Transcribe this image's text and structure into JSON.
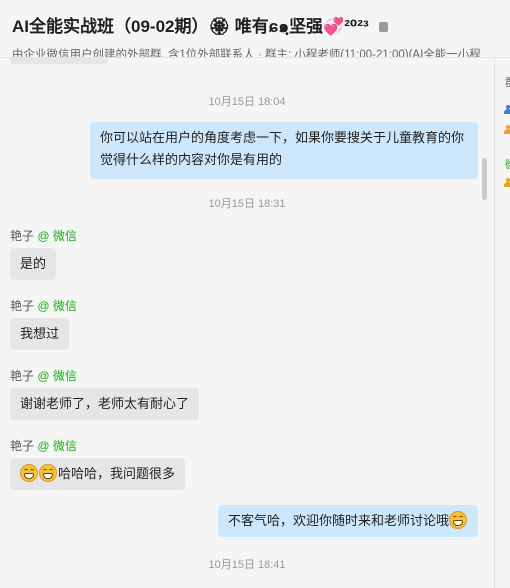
{
  "header": {
    "title": "AI全能实战班（09-02期）🏵 唯有ɕ๑ฺ坚强💞²⁰²³",
    "subtitle": "由企业微信用户创建的外部群, 含1位外部联系人 · 群主: 小程老师(11:00-21;00)(AI全能一小程"
  },
  "side_panel": {
    "glyphs": [
      "群",
      "微"
    ]
  },
  "messages": [
    {
      "kind": "timestamp",
      "text": "10月15日 18:04"
    },
    {
      "kind": "out",
      "text_line1": "你可以站在用户的角度考虑一下，如果你要搜关于儿童教育的你",
      "text_line2": "觉得什么样的内容对你是有用的"
    },
    {
      "kind": "timestamp",
      "text": "10月15日 18:31"
    },
    {
      "kind": "in",
      "sender": "艳子",
      "source": "@ 微信",
      "text": "是的"
    },
    {
      "kind": "in",
      "sender": "艳子",
      "source": "@ 微信",
      "text": "我想过"
    },
    {
      "kind": "in",
      "sender": "艳子",
      "source": "@ 微信",
      "text": "谢谢老师了，老师太有耐心了"
    },
    {
      "kind": "in",
      "sender": "艳子",
      "source": "@ 微信",
      "text": "哈哈哈，我问题很多",
      "emoji": "grinning-face-icon"
    },
    {
      "kind": "out",
      "text": "不客气哈，欢迎你随时来和老师讨论哦",
      "emoji": "grinning-face-icon"
    },
    {
      "kind": "timestamp",
      "text": "10月15日 18:41"
    }
  ]
}
